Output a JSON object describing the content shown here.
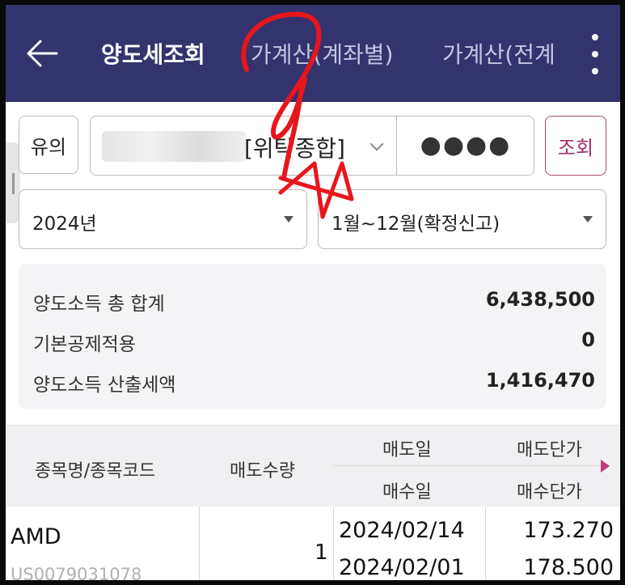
{
  "header": {
    "tabs": [
      {
        "label": "양도세조회",
        "active": true
      },
      {
        "label": "가계산(계좌별)",
        "active": false
      },
      {
        "label": "가계산(전계",
        "active": false
      }
    ],
    "colors": {
      "background": "#33336e",
      "active_text": "#ffffff",
      "inactive_text": "#c5c6e0"
    }
  },
  "filters": {
    "notice_label": "유의",
    "account_type": "[위탁종합]",
    "password_mask": "●●●●",
    "query_label": "조회",
    "year": "2024년",
    "period": "1월~12월(확정신고)"
  },
  "summary": {
    "items": [
      {
        "label": "양도소득 총 합계",
        "value": "6,438,500"
      },
      {
        "label": "기본공제적용",
        "value": "0"
      },
      {
        "label": "양도소득 산출세액",
        "value": "1,416,470"
      }
    ]
  },
  "table": {
    "headers": {
      "name_code": "종목명/종목코드",
      "sell_qty": "매도수량",
      "sell_date": "매도일",
      "buy_date": "매수일",
      "sell_price": "매도단가",
      "buy_price": "매수단가"
    },
    "rows": [
      {
        "name": "AMD",
        "code": "US0079031078",
        "qty": "1",
        "sell_date": "2024/02/14",
        "buy_date": "2024/02/01",
        "sell_price": "173.270",
        "buy_price": "178.500"
      }
    ]
  },
  "icons": {
    "back": "back-arrow-icon",
    "menu": "more-vertical-icon",
    "dropdown": "chevron-down-icon",
    "select": "caret-down-icon",
    "scroll_right": "caret-right-icon"
  },
  "accent_colors": {
    "query_button": "#a0306a",
    "annotation": "#e8161c"
  }
}
